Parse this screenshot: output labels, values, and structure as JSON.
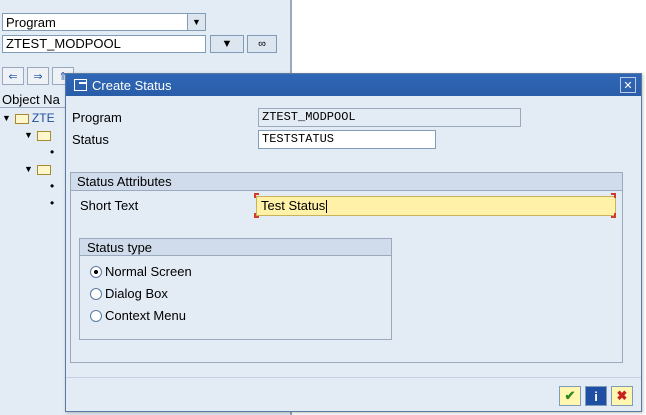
{
  "workbench": {
    "object_type": "Program",
    "object_name": "ZTEST_MODPOOL",
    "tree_header": "Object Na",
    "tree_root": "ZTE"
  },
  "dialog": {
    "title": "Create Status",
    "program_label": "Program",
    "program_value": "ZTEST_MODPOOL",
    "status_label": "Status",
    "status_value": "TESTSTATUS",
    "attributes_title": "Status Attributes",
    "short_text_label": "Short Text",
    "short_text_value": "Test Status",
    "status_type_title": "Status type",
    "status_types": [
      {
        "label": "Normal Screen",
        "selected": true
      },
      {
        "label": "Dialog Box",
        "selected": false
      },
      {
        "label": "Context Menu",
        "selected": false
      }
    ]
  },
  "icons": {
    "confirm": "check-icon",
    "info": "info-icon",
    "cancel": "cancel-icon",
    "close": "close-icon"
  },
  "colors": {
    "titlebar": "#2f67b7",
    "background": "#e3ebf5",
    "required_field": "#fff2a8",
    "confirm_green": "#2f8a1f",
    "cancel_red": "#c62020"
  }
}
